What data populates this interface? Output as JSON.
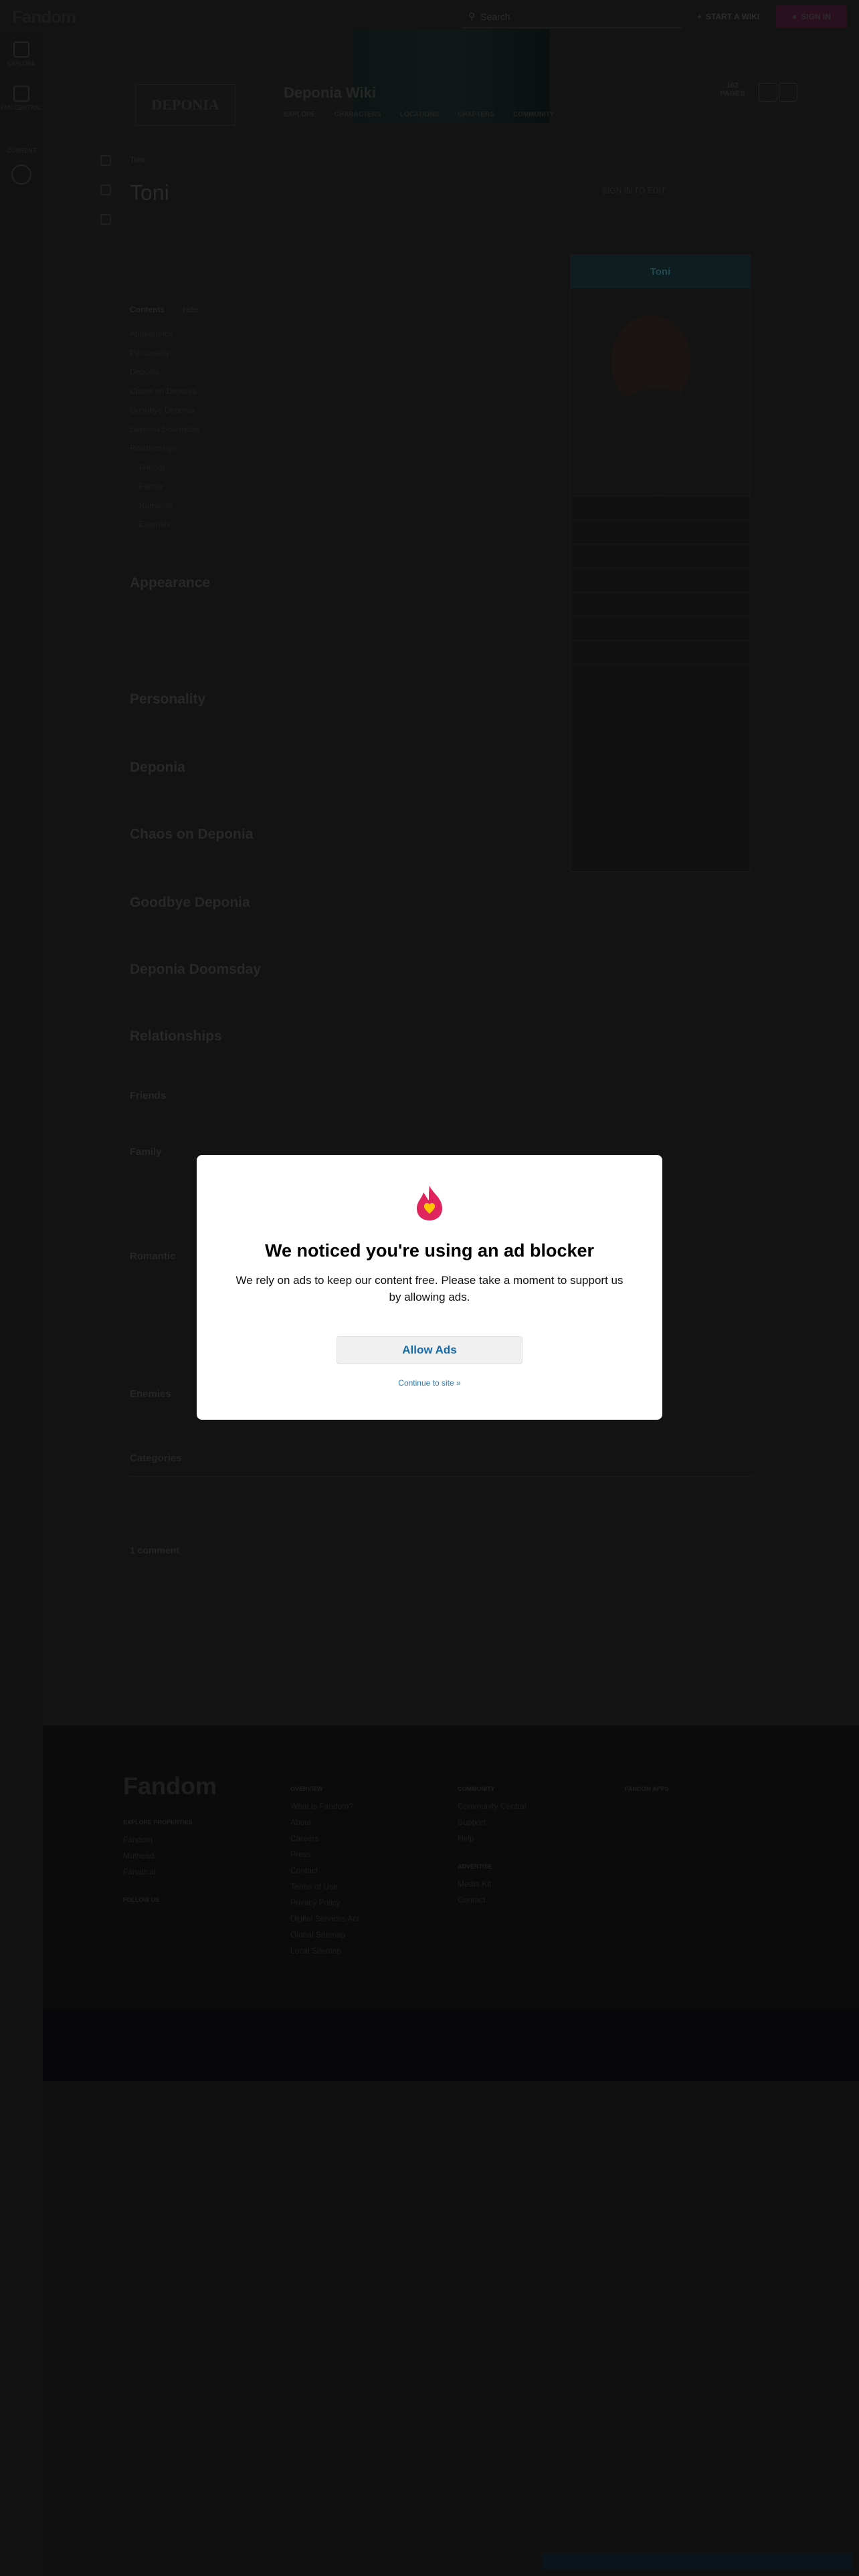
{
  "header": {
    "logo_text": "Fandom",
    "search_placeholder": "Search",
    "start_wiki_label": "START A WIKI",
    "sign_in_label": "SIGN IN"
  },
  "rail": {
    "items": [
      {
        "label": "EXPLORE",
        "icon": "grid-icon"
      },
      {
        "label": "FAN CENTRAL",
        "icon": "home-icon"
      }
    ],
    "current_label": "CURRENT"
  },
  "wiki": {
    "logo_text": "DEPONIA",
    "name": "Deponia Wiki",
    "nav": [
      "EXPLORE",
      "CHARACTERS",
      "LOCATIONS",
      "CHAPTERS",
      "COMMUNITY"
    ],
    "pages_count": "162",
    "pages_label": "PAGES"
  },
  "article": {
    "breadcrumb": "Toni",
    "title": "Toni",
    "actions": [
      "SIGN IN TO EDIT"
    ],
    "toc_title": "Contents",
    "toc_toggle": "hide",
    "toc": [
      "Appearance",
      "Personality",
      "Deponia",
      "Chaos on Deponia",
      "Goodbye Deponia",
      "Deponia Doomsday",
      "Relationships",
      "Friends",
      "Family",
      "Romantic",
      "Enemies"
    ],
    "sections": {
      "appearance": "Appearance",
      "personality": "Personality",
      "deponia": "Deponia",
      "chaos": "Chaos on Deponia",
      "goodbye": "Goodbye Deponia",
      "doomsday": "Deponia Doomsday",
      "relationships": "Relationships",
      "friends": "Friends",
      "family": "Family",
      "romantic": "Romantic",
      "enemies": "Enemies"
    }
  },
  "infobox": {
    "title": "Toni"
  },
  "page_bottom": {
    "categories_label": "Categories",
    "comments_label": "1 comment"
  },
  "footer": {
    "logo_text": "Fandom",
    "cols": [
      {
        "heading": "EXPLORE PROPERTIES",
        "links": [
          "Fandom",
          "Muthead",
          "Fanatical"
        ]
      },
      {
        "heading": "OVERVIEW",
        "links": [
          "What is Fandom?",
          "About",
          "Careers",
          "Press",
          "Contact",
          "Terms of Use",
          "Privacy Policy",
          "Digital Services Act",
          "Global Sitemap",
          "Local Sitemap"
        ]
      },
      {
        "heading": "COMMUNITY",
        "links": [
          "Community Central",
          "Support",
          "Help"
        ]
      },
      {
        "heading": "FANDOM APPS",
        "links": []
      }
    ],
    "follow_label": "FOLLOW US",
    "advertise_heading": "ADVERTISE",
    "advertise_links": [
      "Media Kit",
      "Contact"
    ]
  },
  "modal": {
    "title": "We noticed you're using an ad blocker",
    "body": "We rely on ads to keep our content free. Please take a moment to support us by allowing ads.",
    "allow_label": "Allow Ads",
    "continue_label": "Continue to site »",
    "accent_color": "#e0255e"
  }
}
